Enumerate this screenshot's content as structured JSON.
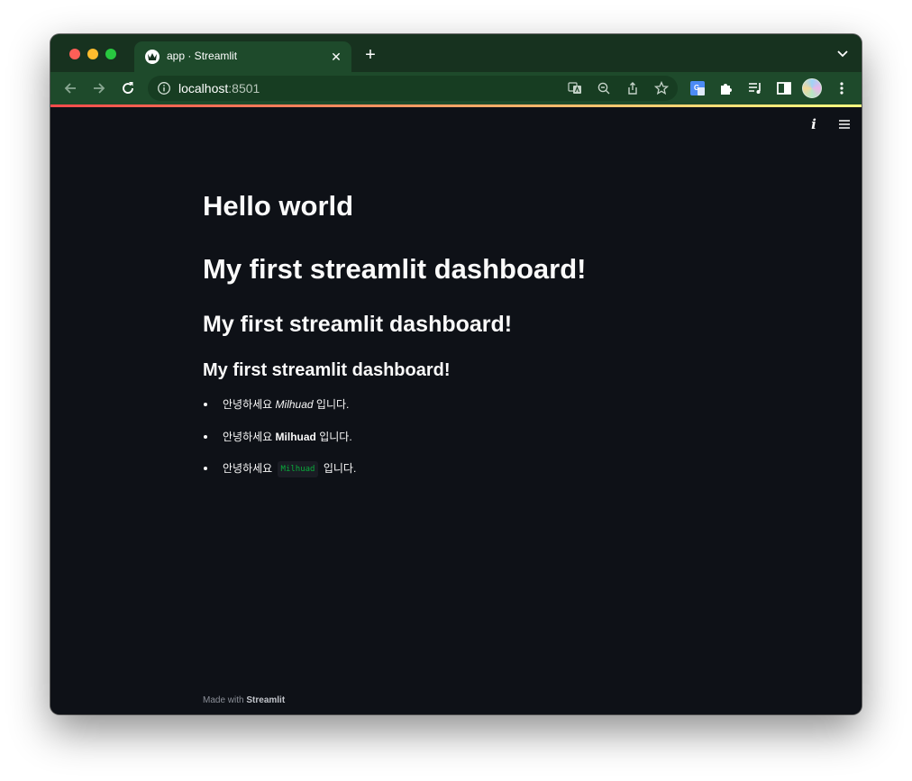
{
  "browser": {
    "tab": {
      "title": "app · Streamlit",
      "favicon": "streamlit-crown-icon",
      "close_label": "✕"
    },
    "new_tab_label": "+",
    "url_host": "localhost",
    "url_port": ":8501",
    "colors": {
      "tabbar": "#17321f",
      "toolbar": "#1e4a2b",
      "omnibox": "#173d22"
    }
  },
  "streamlit": {
    "header": {
      "info_label": "i"
    },
    "headings": {
      "title": "Hello world",
      "h1": "My first streamlit dashboard!",
      "h2": "My first streamlit dashboard!",
      "h3": "My first streamlit dashboard!"
    },
    "list": [
      {
        "prefix": "안녕하세요",
        "name": "Milhuad",
        "suffix": "입니다.",
        "style": "italic"
      },
      {
        "prefix": "안녕하세요",
        "name": "Milhuad",
        "suffix": "입니다.",
        "style": "bold"
      },
      {
        "prefix": "안녕하세요",
        "name": "Milhuad",
        "suffix": "입니다.",
        "style": "code"
      }
    ],
    "footer": {
      "made_with": "Made with",
      "brand": "Streamlit"
    },
    "colors": {
      "background": "#0e1117",
      "text": "#fafafa",
      "code_text": "#09ab3b",
      "accent_gradient_start": "#ff4b4b",
      "accent_gradient_end": "#fffd80"
    }
  }
}
